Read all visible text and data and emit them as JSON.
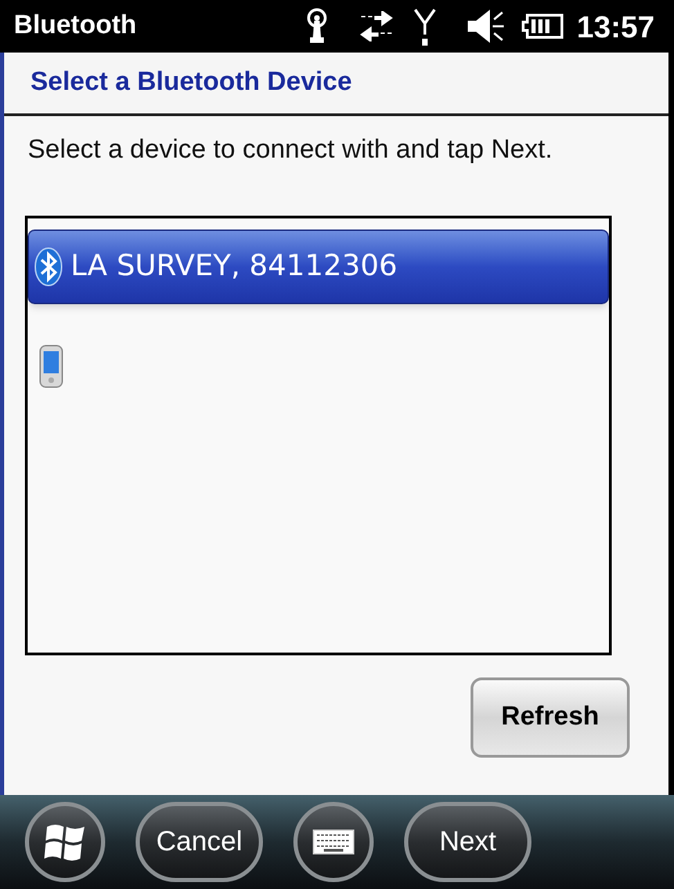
{
  "status_bar": {
    "title": "Bluetooth",
    "time": "13:57"
  },
  "header": {
    "title": "Select a Bluetooth Device"
  },
  "instructions": "Select a device to connect with and tap Next.",
  "devices": [
    {
      "kind": "bluetooth",
      "label": "LA SURVEY, 84112306",
      "selected": true
    },
    {
      "kind": "phone",
      "selected": false
    }
  ],
  "refresh_button": "Refresh",
  "softkeys": [
    {
      "kind": "start"
    },
    {
      "kind": "text",
      "label": "Cancel"
    },
    {
      "kind": "keyboard"
    },
    {
      "kind": "text",
      "label": "Next"
    }
  ]
}
